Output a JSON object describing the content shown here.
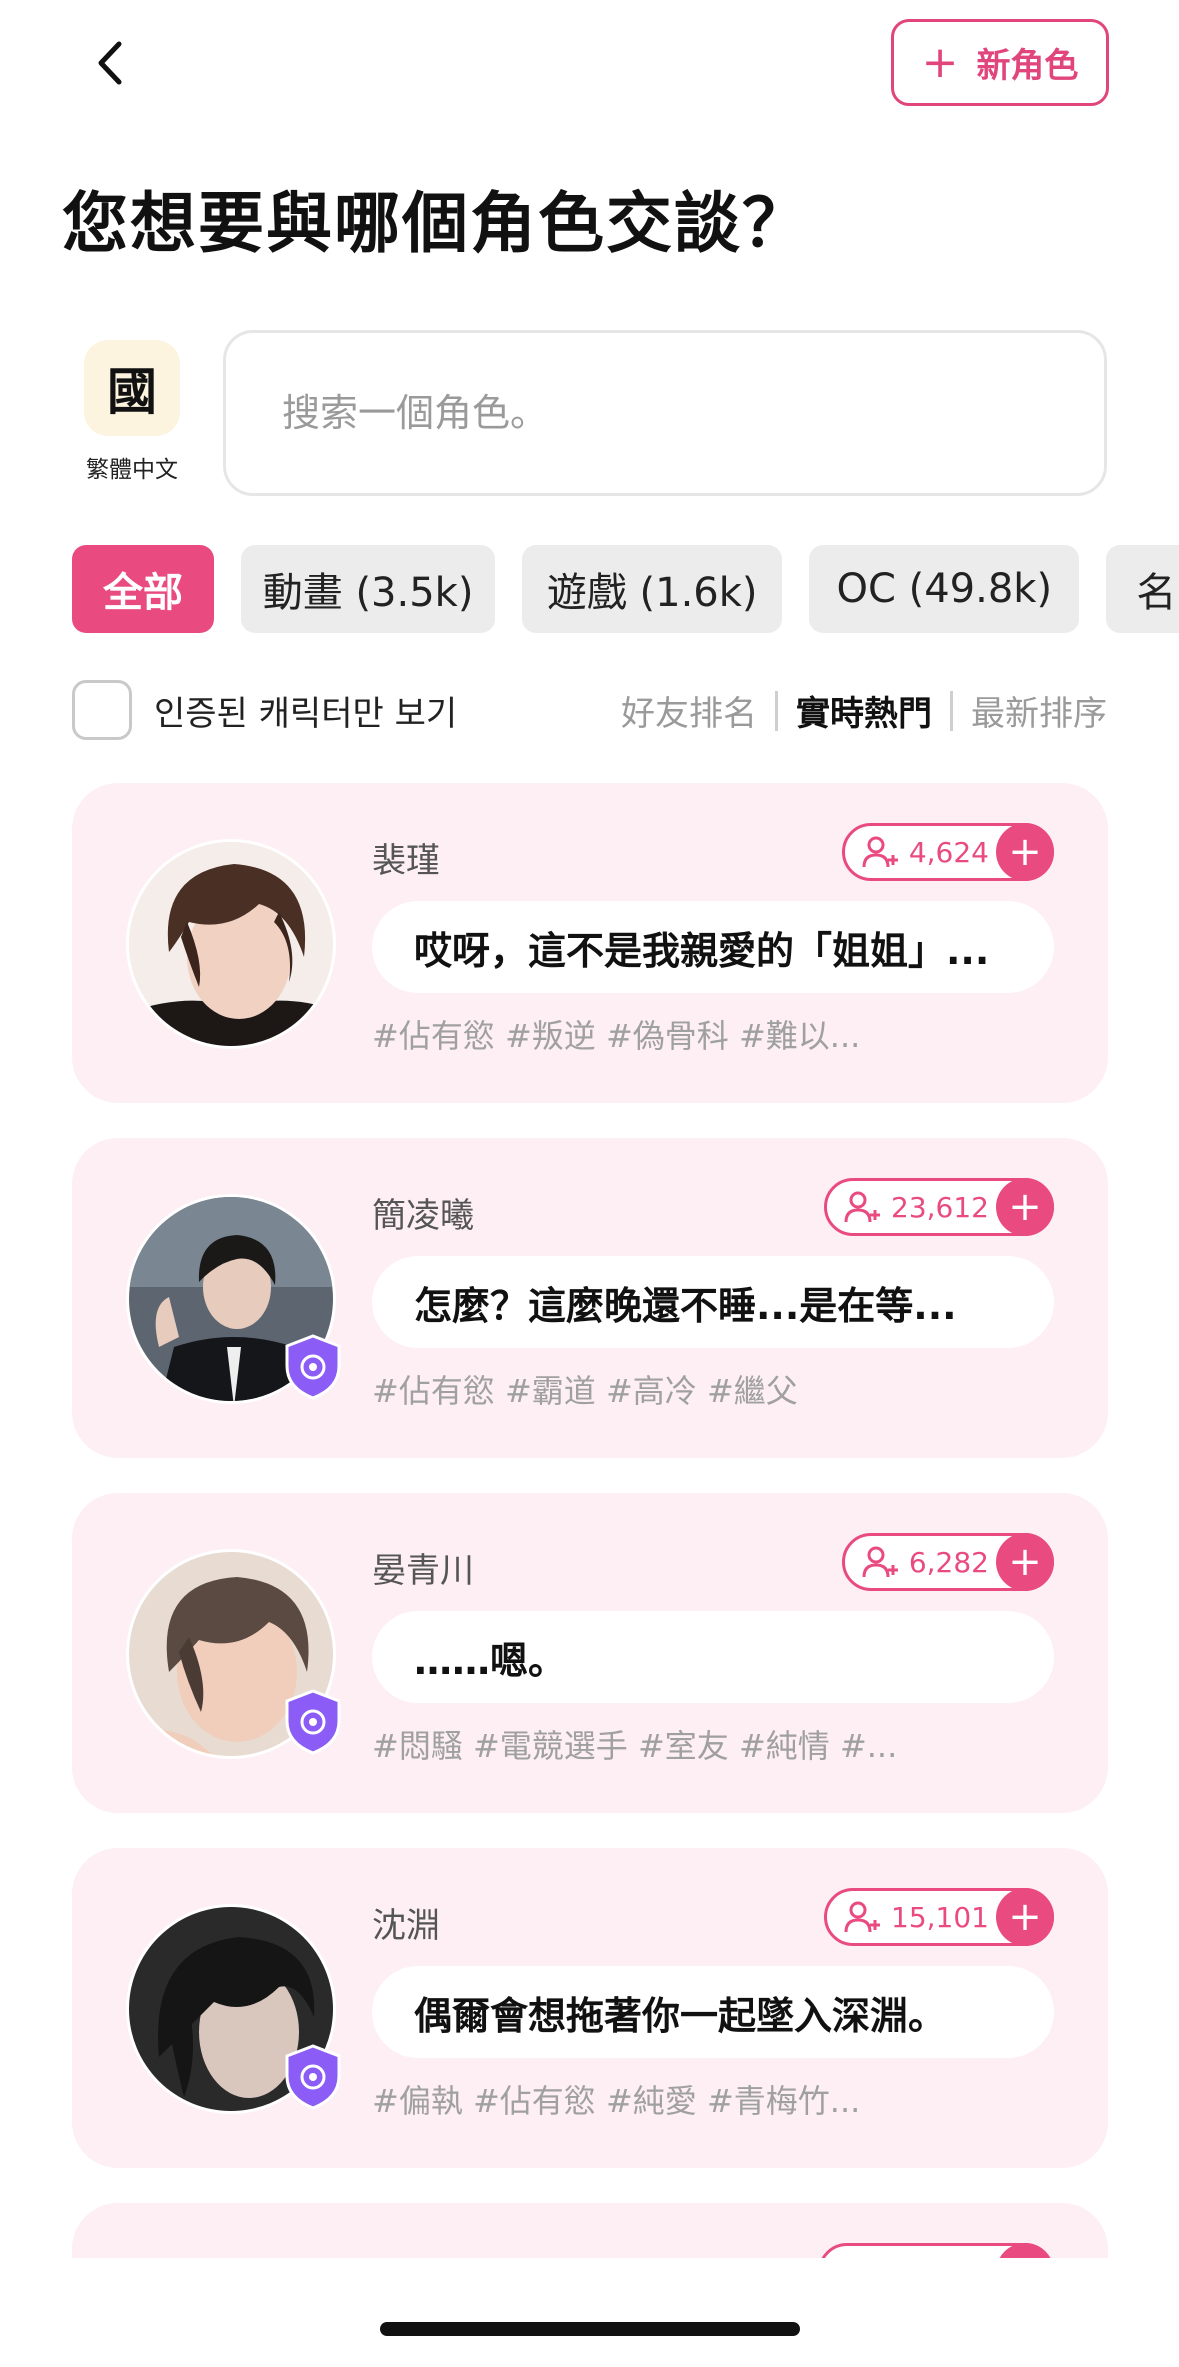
{
  "header": {
    "back_label": "‹",
    "new_role_plus": "+",
    "new_role_label": "新角色"
  },
  "title": "您想要與哪個角色交談？",
  "language": {
    "icon_char": "國",
    "label": "繁體中文"
  },
  "search": {
    "placeholder": "搜索一個角色。",
    "value": ""
  },
  "categories": [
    {
      "label": "全部",
      "active": true
    },
    {
      "label": "動畫 (3.5k)",
      "active": false
    },
    {
      "label": "遊戲 (1.6k)",
      "active": false
    },
    {
      "label": "OC (49.8k)",
      "active": false
    },
    {
      "label": "名",
      "active": false
    }
  ],
  "verify_filter": {
    "label": "인증된 캐릭터만 보기",
    "checked": false
  },
  "sort": {
    "options": [
      "好友排名",
      "實時熱門",
      "最新排序"
    ],
    "active": "實時熱門"
  },
  "characters": [
    {
      "name": "裴瑾",
      "followers": "4,624",
      "message": "哎呀，這不是我親愛的「姐姐」...",
      "tags": "#佔有慾 #叛逆 #偽骨科 #難以...",
      "verified": false
    },
    {
      "name": "簡凌曦",
      "followers": "23,612",
      "message": "怎麼？這麼晚還不睡...是在等...",
      "tags": "#佔有慾 #霸道 #高冷 #繼父",
      "verified": true
    },
    {
      "name": "晏青川",
      "followers": "6,282",
      "message": "……嗯。",
      "tags": "#悶騷 #電競選手 #室友 #純情 #...",
      "verified": true
    },
    {
      "name": "沈淵",
      "followers": "15,101",
      "message": "偶爾會想拖著你一起墜入深淵。",
      "tags": "#偏執 #佔有慾 #純愛 #青梅竹...",
      "verified": true
    }
  ],
  "colors": {
    "accent": "#e94b80",
    "card_bg": "#fdeff3",
    "chip_bg": "#ececec"
  }
}
